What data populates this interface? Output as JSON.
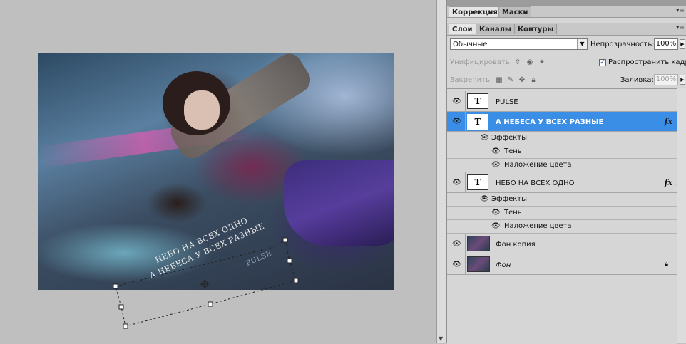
{
  "panel": {
    "top_tabs": [
      {
        "label": "Коррекция",
        "active": true
      },
      {
        "label": "Маски",
        "active": false
      }
    ],
    "layers_tabs": [
      {
        "label": "Слои",
        "active": true
      },
      {
        "label": "Каналы",
        "active": false
      },
      {
        "label": "Контуры",
        "active": false
      }
    ],
    "blend_mode": "Обычные",
    "opacity_label": "Непрозрачность:",
    "opacity_value": "100%",
    "unify_label": "Унифицировать:",
    "propagate_label": "Распространить кадр",
    "propagate_checked": "✓",
    "lock_label": "Закрепить:",
    "fill_label": "Заливка:",
    "fill_value": "100%",
    "menu_icon": "▾≡"
  },
  "canvas_text": {
    "line1": "НЕБО НА ВСЕХ ОДНО",
    "line2": "А НЕБЕСА У ВСЕХ РАЗНЫЕ",
    "line3": "PULSE"
  },
  "layers": [
    {
      "name": "PULSE",
      "type": "text",
      "thumb": "T",
      "selected": false
    },
    {
      "name": "А НЕБЕСА У ВСЕХ РАЗНЫЕ",
      "type": "text",
      "thumb": "T",
      "selected": true,
      "fx": "fx",
      "effects_label": "Эффекты",
      "effects": [
        "Тень",
        "Наложение цвета"
      ]
    },
    {
      "name": "НЕБО НА ВСЕХ ОДНО",
      "type": "text",
      "thumb": "T",
      "selected": false,
      "fx": "fx",
      "effects_label": "Эффекты",
      "effects": [
        "Тень",
        "Наложение цвета"
      ]
    },
    {
      "name": "Фон копия",
      "type": "image",
      "selected": false
    },
    {
      "name": "Фон",
      "type": "image",
      "selected": false,
      "locked": true
    }
  ],
  "colors": {
    "selection": "#3a8ee6",
    "panel": "#d6d6d6",
    "canvas_bg": "#bfbfbf"
  }
}
